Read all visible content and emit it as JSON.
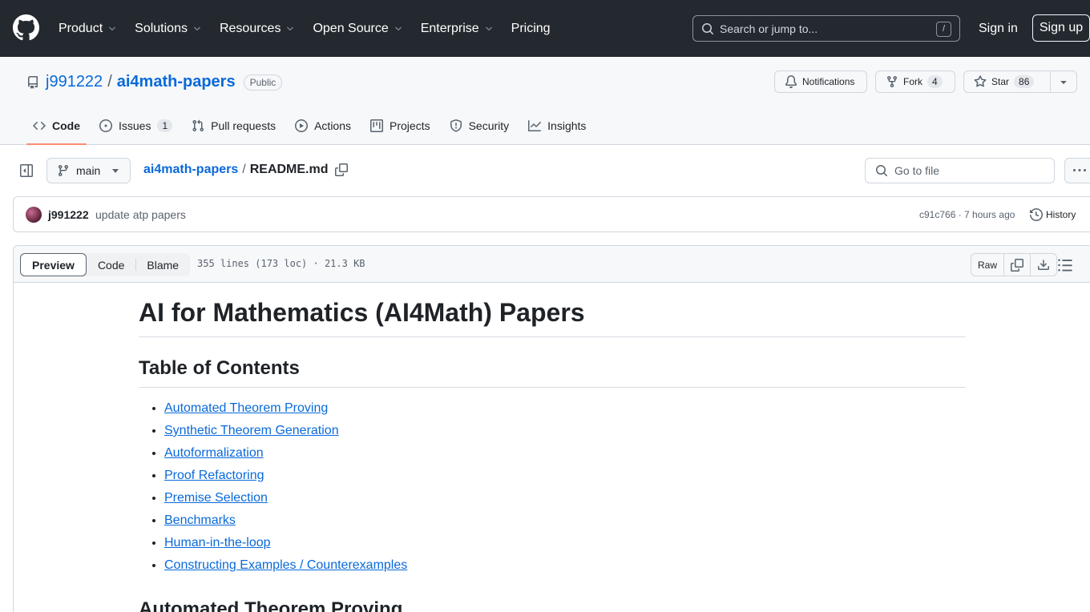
{
  "header": {
    "nav": [
      {
        "label": "Product",
        "has_menu": true
      },
      {
        "label": "Solutions",
        "has_menu": true
      },
      {
        "label": "Resources",
        "has_menu": true
      },
      {
        "label": "Open Source",
        "has_menu": true
      },
      {
        "label": "Enterprise",
        "has_menu": true
      },
      {
        "label": "Pricing",
        "has_menu": false
      }
    ],
    "search_placeholder": "Search or jump to...",
    "search_shortcut": "/",
    "sign_in": "Sign in",
    "sign_up": "Sign up"
  },
  "repo": {
    "owner": "j991222",
    "separator": "/",
    "name": "ai4math-papers",
    "visibility": "Public",
    "notifications_label": "Notifications",
    "fork_label": "Fork",
    "fork_count": "4",
    "star_label": "Star",
    "star_count": "86",
    "tabs": [
      {
        "label": "Code",
        "active": true,
        "count": ""
      },
      {
        "label": "Issues",
        "active": false,
        "count": "1"
      },
      {
        "label": "Pull requests",
        "active": false,
        "count": ""
      },
      {
        "label": "Actions",
        "active": false,
        "count": ""
      },
      {
        "label": "Projects",
        "active": false,
        "count": ""
      },
      {
        "label": "Security",
        "active": false,
        "count": ""
      },
      {
        "label": "Insights",
        "active": false,
        "count": ""
      }
    ]
  },
  "file_nav": {
    "branch": "main",
    "crumb_repo": "ai4math-papers",
    "crumb_sep": "/",
    "crumb_file": "README.md",
    "goto_placeholder": "Go to file"
  },
  "commit": {
    "author": "j991222",
    "message": "update atp papers",
    "meta": "c91c766 · 7 hours ago",
    "history_label": "History"
  },
  "file": {
    "view_tabs": [
      "Preview",
      "Code",
      "Blame"
    ],
    "active_view": "Preview",
    "info": "355 lines (173 loc) · 21.3 KB",
    "raw_label": "Raw"
  },
  "readme": {
    "title": "AI for Mathematics (AI4Math) Papers",
    "toc_heading": "Table of Contents",
    "toc": [
      "Automated Theorem Proving",
      "Synthetic Theorem Generation",
      "Autoformalization",
      "Proof Refactoring",
      "Premise Selection",
      "Benchmarks",
      "Human-in-the-loop",
      "Constructing Examples / Counterexamples"
    ],
    "next_heading": "Automated Theorem Proving"
  },
  "colors": {
    "header_bg": "#24292f",
    "link": "#0969da",
    "tab_underline": "#fd8c73",
    "muted": "#59636e",
    "border": "#d0d7de"
  }
}
